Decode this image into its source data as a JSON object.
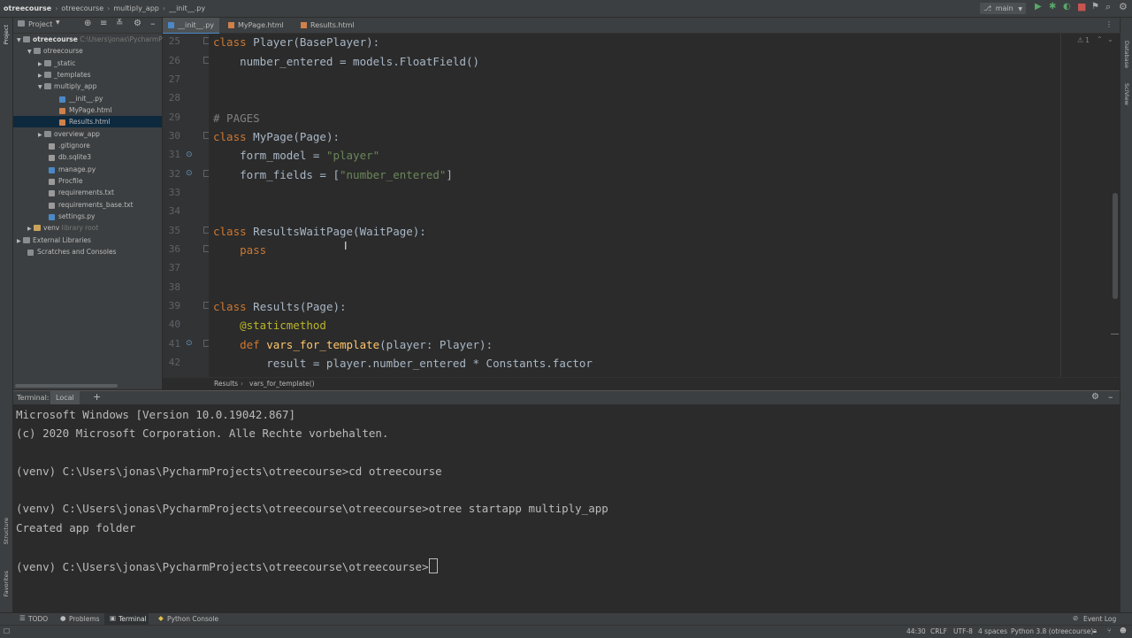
{
  "breadcrumbs": [
    "otreecourse",
    "otreecourse",
    "multiply_app",
    "__init__.py"
  ],
  "toolbar": {
    "branch": "main"
  },
  "left_strip": {
    "project": "Project",
    "structure": "Structure",
    "favorites": "Favorites"
  },
  "right_strip": {
    "database": "Database",
    "sciview": "SciView"
  },
  "project_panel": {
    "title": "Project"
  },
  "tree": [
    {
      "label": "otreecourse",
      "extra": "C:\\Users\\jonas\\PycharmP"
    },
    {
      "label": "otreecourse"
    },
    {
      "label": "_static"
    },
    {
      "label": "_templates"
    },
    {
      "label": "multiply_app"
    },
    {
      "label": "__init__.py"
    },
    {
      "label": "MyPage.html"
    },
    {
      "label": "Results.html"
    },
    {
      "label": "overview_app"
    },
    {
      "label": ".gitignore"
    },
    {
      "label": "db.sqlite3"
    },
    {
      "label": "manage.py"
    },
    {
      "label": "Procfile"
    },
    {
      "label": "requirements.txt"
    },
    {
      "label": "requirements_base.txt"
    },
    {
      "label": "settings.py"
    },
    {
      "label": "venv",
      "extra": "library root"
    },
    {
      "label": "External Libraries"
    },
    {
      "label": "Scratches and Consoles"
    }
  ],
  "tabs": [
    {
      "label": "__init__.py"
    },
    {
      "label": "MyPage.html"
    },
    {
      "label": "Results.html"
    }
  ],
  "editor": {
    "warnings": "1",
    "line_numbers": [
      "25",
      "26",
      "27",
      "28",
      "29",
      "30",
      "31",
      "32",
      "33",
      "34",
      "35",
      "36",
      "37",
      "38",
      "39",
      "40",
      "41",
      "42"
    ],
    "code": {
      "l25_kw": "class",
      "l25_rest": " Player(BasePlayer):",
      "l26": "    number_entered = models.FloatField()",
      "l29": "# PAGES",
      "l30_kw": "class",
      "l30_rest": " MyPage(Page):",
      "l31_a": "    form_model = ",
      "l31_str": "\"player\"",
      "l32_a": "    form_fields = [",
      "l32_str": "\"number_entered\"",
      "l32_b": "]",
      "l35_kw": "class",
      "l35_rest": " ResultsWaitPage(WaitPage):",
      "l36": "    pass",
      "l39_kw": "class",
      "l39_rest": " Results(Page):",
      "l40": "    @staticmethod",
      "l41_kw": "    def ",
      "l41_fn": "vars_for_template",
      "l41_rest": "(player: Player):",
      "l42": "        result = player.number_entered * Constants.factor"
    },
    "crumbs": [
      "Results",
      "vars_for_template()"
    ]
  },
  "terminal": {
    "title": "Terminal:",
    "tab": "Local",
    "lines": [
      "Microsoft Windows [Version 10.0.19042.867]",
      "(c) 2020 Microsoft Corporation. Alle Rechte vorbehalten.",
      "",
      "(venv) C:\\Users\\jonas\\PycharmProjects\\otreecourse>cd otreecourse",
      "",
      "(venv) C:\\Users\\jonas\\PycharmProjects\\otreecourse\\otreecourse>otree startapp multiply_app",
      "Created app folder",
      "",
      "(venv) C:\\Users\\jonas\\PycharmProjects\\otreecourse\\otreecourse>"
    ]
  },
  "bottom_tools": [
    "TODO",
    "Problems",
    "Terminal",
    "Python Console"
  ],
  "event_log": "Event Log",
  "status": {
    "position": "44:30",
    "line_sep": "CRLF",
    "encoding": "UTF-8",
    "indent": "4 spaces",
    "interpreter": "Python 3.8 (otreecourse)"
  },
  "colors": {
    "accent": "#4a88c7",
    "selection": "#0d293e",
    "keyword": "#cc7832",
    "string": "#6a8759",
    "function": "#ffc66d",
    "decorator": "#bbb529"
  }
}
